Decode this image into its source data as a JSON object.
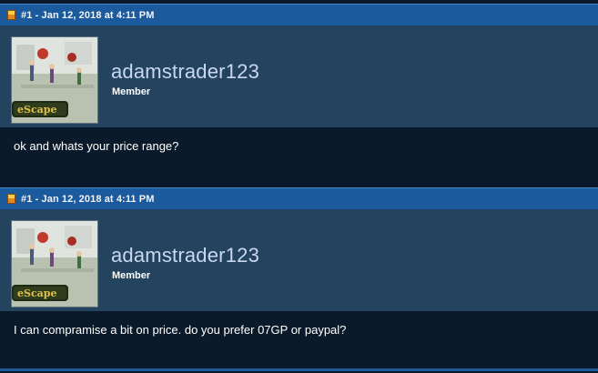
{
  "posts": [
    {
      "number_date": "#1 - Jan 12, 2018 at 4:11 PM",
      "username": "adamstrader123",
      "role": "Member",
      "avatar_logo": "eScape",
      "message": "ok and whats your price range?"
    },
    {
      "number_date": "#1 - Jan 12, 2018 at 4:11 PM",
      "username": "adamstrader123",
      "role": "Member",
      "avatar_logo": "eScape",
      "message": "I can compramise a bit on price. do you prefer 07GP or paypal?"
    }
  ],
  "icons": {
    "post_icon": "document-icon"
  },
  "colors": {
    "header_bar": "#1b5a9c",
    "user_panel": "#23435f",
    "body_bg": "#0b1a2a",
    "username": "#c9d8ee"
  }
}
